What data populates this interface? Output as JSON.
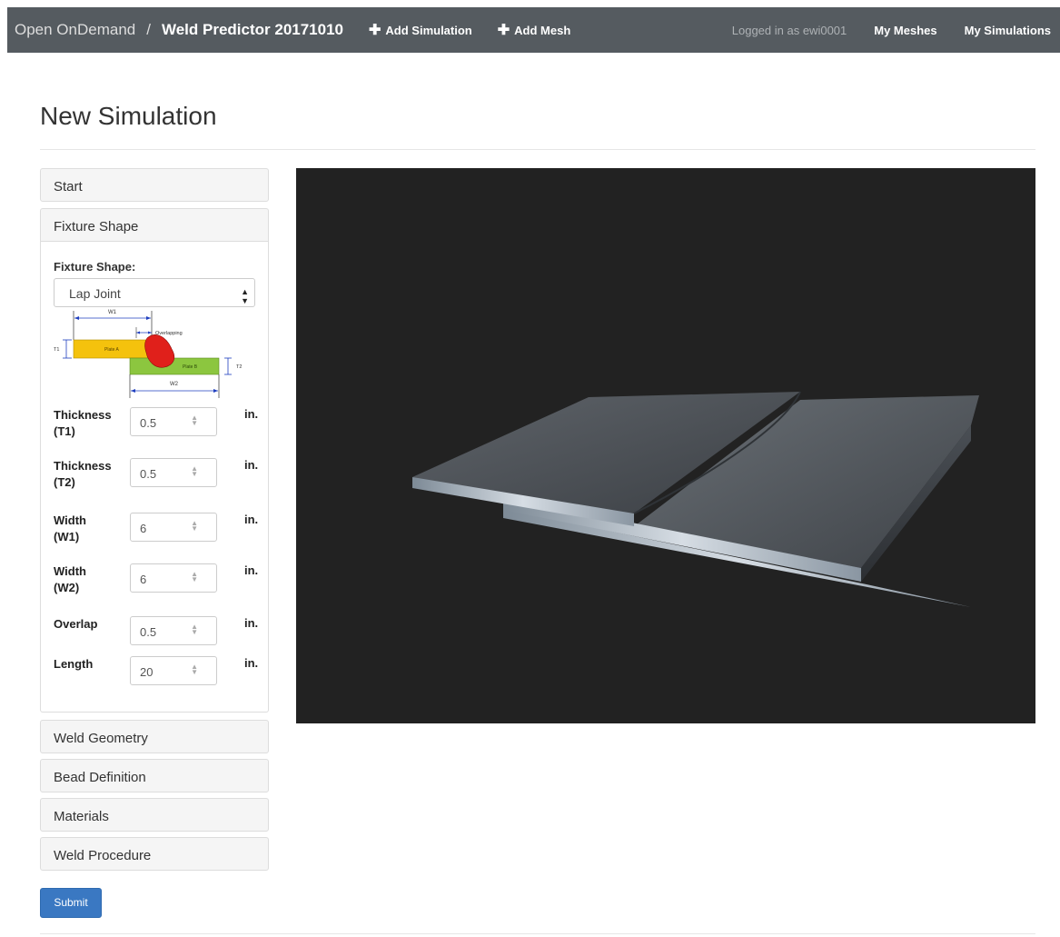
{
  "navbar": {
    "brand": "Open OnDemand",
    "separator": "/",
    "app_name": "Weld Predictor 20171010",
    "add_simulation": "Add Simulation",
    "add_mesh": "Add Mesh",
    "logged_in": "Logged in as ewi0001",
    "my_meshes": "My Meshes",
    "my_simulations": "My Simulations"
  },
  "page": {
    "title": "New Simulation"
  },
  "panels": {
    "start": "Start",
    "fixture_shape": "Fixture Shape",
    "weld_geometry": "Weld Geometry",
    "bead_definition": "Bead Definition",
    "materials": "Materials",
    "weld_procedure": "Weld Procedure"
  },
  "fixture": {
    "label": "Fixture Shape:",
    "selected": "Lap Joint",
    "diagram": {
      "w1": "W1",
      "w2": "W2",
      "t1": "T1",
      "t2": "T2",
      "overlapping": "Overlapping",
      "plate_a": "Plate A",
      "plate_b": "Plate B"
    },
    "fields": [
      {
        "label_line1": "Thickness",
        "label_line2": "(T1)",
        "value": "0.5",
        "unit": "in."
      },
      {
        "label_line1": "Thickness",
        "label_line2": "(T2)",
        "value": "0.5",
        "unit": "in."
      },
      {
        "label_line1": "Width",
        "label_line2": "(W1)",
        "value": "6",
        "unit": "in."
      },
      {
        "label_line1": "Width",
        "label_line2": "(W2)",
        "value": "6",
        "unit": "in."
      },
      {
        "label_line1": "Overlap",
        "label_line2": "",
        "value": "0.5",
        "unit": "in."
      },
      {
        "label_line1": "Length",
        "label_line2": "",
        "value": "20",
        "unit": "in."
      }
    ]
  },
  "submit_label": "Submit",
  "colors": {
    "navbar": "#555b60",
    "plate_a": "#f4c20d",
    "plate_b": "#8cc63f",
    "weld_bead": "#e0201b",
    "viewer_bg": "#222222",
    "submit": "#3a78c2"
  }
}
